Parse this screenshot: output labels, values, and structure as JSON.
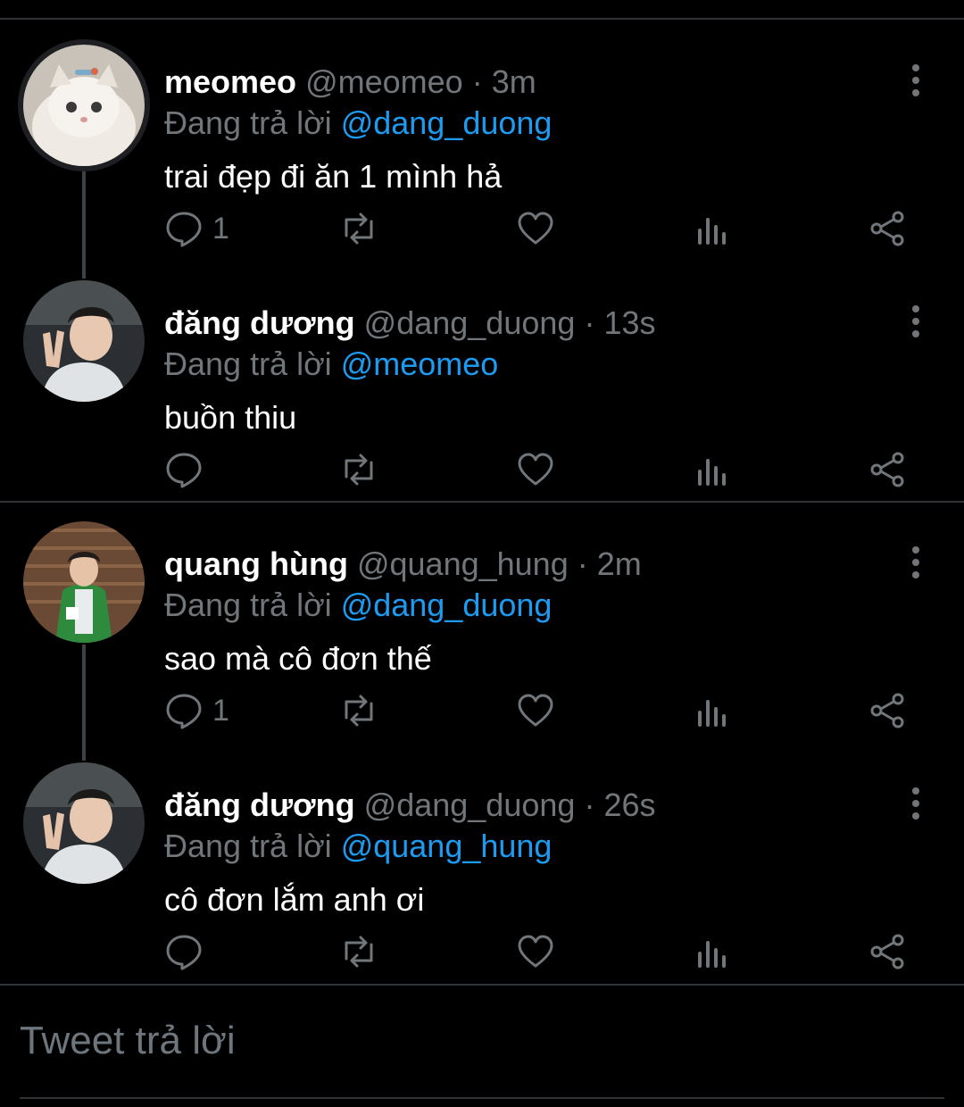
{
  "tweets": [
    {
      "name": "meomeo",
      "handle": "@meomeo",
      "dot": "·",
      "time": "3m",
      "reply_prefix": "Đang trả lời ",
      "reply_to": "@dang_duong",
      "text": "trai đẹp đi ăn 1 mình hả",
      "reply_count": "1",
      "avatar_icon": "cat-avatar"
    },
    {
      "name": "đăng dương",
      "handle": "@dang_duong",
      "dot": "·",
      "time": "13s",
      "reply_prefix": "Đang trả lời ",
      "reply_to": "@meomeo",
      "text": "buồn thiu",
      "reply_count": "",
      "avatar_icon": "person-peace-sign-avatar"
    },
    {
      "name": "quang hùng",
      "handle": "@quang_hung",
      "dot": "·",
      "time": "2m",
      "reply_prefix": "Đang trả lời ",
      "reply_to": "@dang_duong",
      "text": "sao mà cô đơn thế",
      "reply_count": "1",
      "avatar_icon": "person-green-jacket-avatar"
    },
    {
      "name": "đăng dương",
      "handle": "@dang_duong",
      "dot": "·",
      "time": "26s",
      "reply_prefix": "Đang trả lời ",
      "reply_to": "@quang_hung",
      "text": "cô đơn lắm anh ơi",
      "reply_count": "",
      "avatar_icon": "person-peace-sign-avatar"
    }
  ],
  "composer": {
    "placeholder": "Tweet trả lời"
  },
  "colors": {
    "background": "#000000",
    "mention": "#1d9bf0",
    "secondary_text": "#71767b",
    "divider": "#2f3336"
  }
}
